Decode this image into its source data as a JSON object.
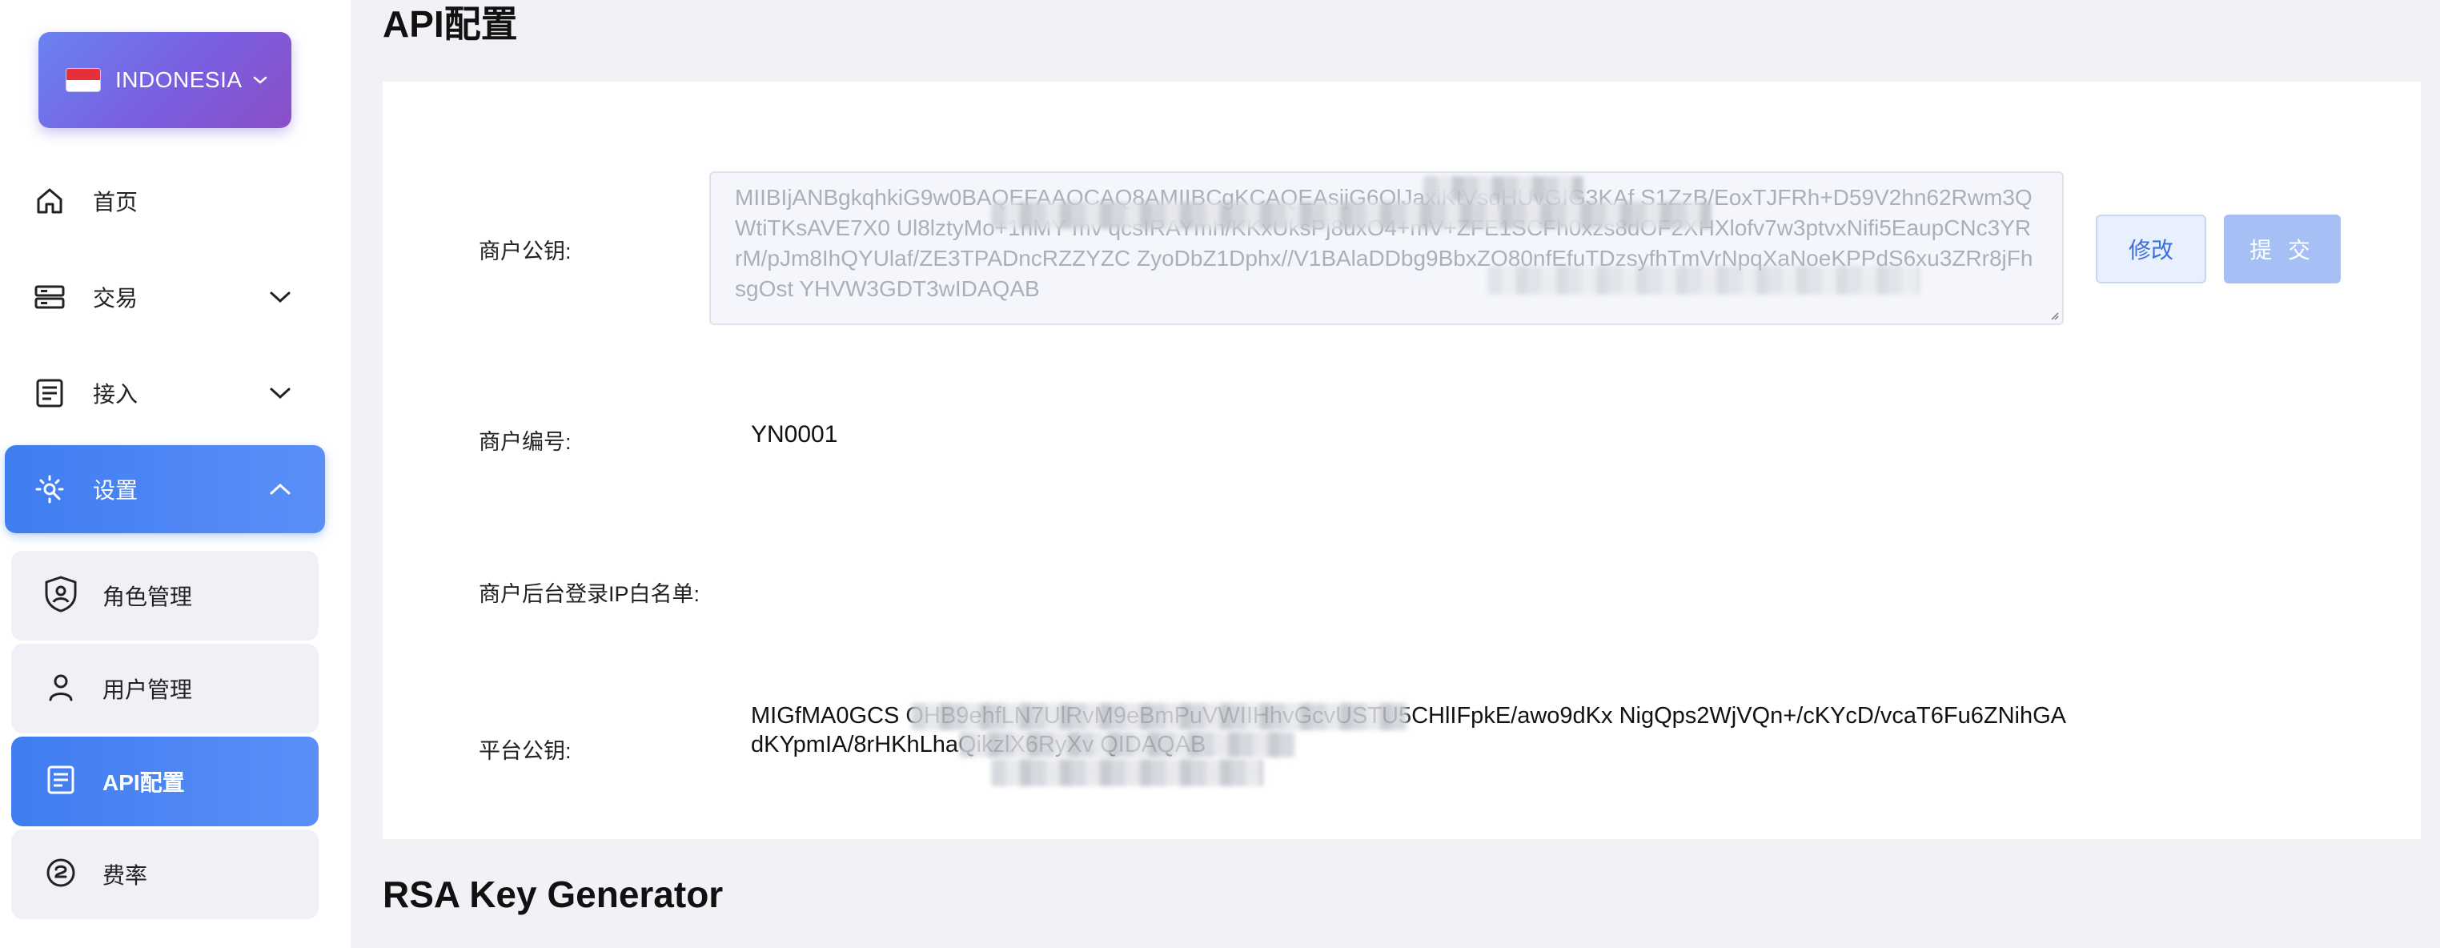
{
  "sidebar": {
    "country": {
      "label": "INDONESIA",
      "flag": "indonesia-flag"
    },
    "nav": [
      {
        "label": "首页",
        "icon": "home-icon"
      },
      {
        "label": "交易",
        "icon": "server-icon",
        "expandable": true
      },
      {
        "label": "接入",
        "icon": "document-icon",
        "expandable": true
      },
      {
        "label": "设置",
        "icon": "settings-icon",
        "expandable": true,
        "expanded": true,
        "active": true
      }
    ],
    "sub_items": [
      {
        "label": "角色管理",
        "icon": "shield-user-icon"
      },
      {
        "label": "用户管理",
        "icon": "user-icon"
      },
      {
        "label": "API配置",
        "icon": "document-icon",
        "active": true
      },
      {
        "label": "费率",
        "icon": "rate-icon"
      }
    ]
  },
  "main": {
    "title": "API配置",
    "fields": {
      "merchant_public_key": {
        "label": "商户公钥:",
        "value": "MIIBIjANBgkqhkiG9w0BAQEFAAOCAQ8AMIIBCgKCAQEAsijG6OlJaxiKtVsqHUvGIG3KAf          S1ZzB/EoxTJFRh+D59V2hn62Rwm3QWtiTKsAVE7X0       Ul8lztyMo+1nMY                             mv       qcsIRAYmh/KKxUksPj8uxO4+mV+ZFE1SCFh0xzs8dOF2XHXlofv7w3ptvxNifi5EaupCNc3YRrM/pJm8IhQYUlaf/ZE3TPADncRZZYZC   ZyoDbZ1Dphx//V1BAlaDDbg9BbxZO80nfEfuTDzsyfhTmVrNpqXaNoeKPPdS6xu3ZRr8jFhsgOst                   YHVW3GDT3wIDAQAB"
      },
      "merchant_id": {
        "label": "商户编号:",
        "value": "YN0001"
      },
      "ip_whitelist": {
        "label": "商户后台登录IP白名单:",
        "value": ""
      },
      "platform_public_key": {
        "label": "平台公钥:",
        "value": "MIGfMA0GCS                              OHB9ehfLN7UlRvM9eBmPuVWIIHhvGcvUSTU5CHlIFpkE/awo9dKx           NigQps2WjVQn+/cKYcD/vcaT6Fu6ZNihGAdKYpmIA/8rHKhLhaQikzlX6RyXv                   QIDAQAB"
      }
    },
    "buttons": {
      "edit": "修改",
      "submit": "提 交"
    },
    "section_title": "RSA Key Generator"
  },
  "colors": {
    "accent": "#4a84f4",
    "gradient_start": "#6a83f0",
    "gradient_end": "#8a4fc7"
  }
}
